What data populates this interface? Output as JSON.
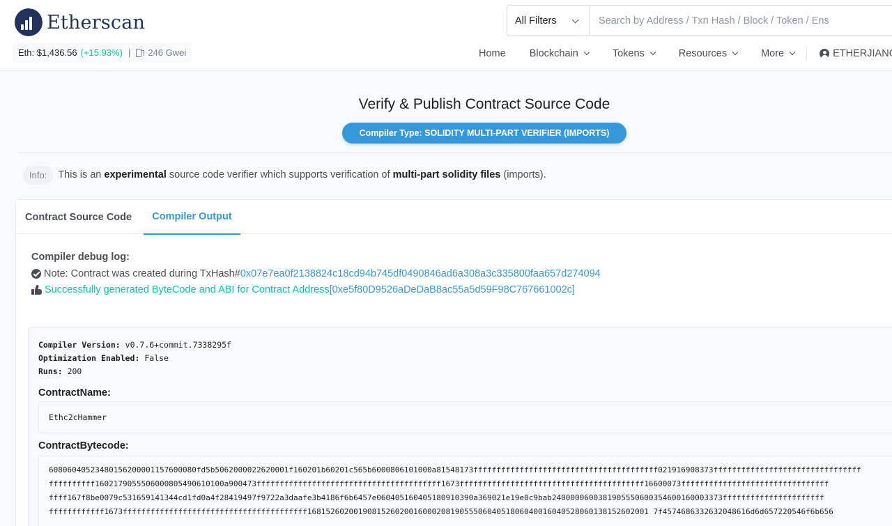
{
  "header": {
    "logo_text": "Etherscan",
    "price": {
      "label": "Eth: $1,436.56",
      "change": "(+15.93%)",
      "separator": "|",
      "gas": "246 Gwei"
    },
    "search": {
      "filter_label": "All Filters",
      "placeholder": "Search by Address / Txn Hash / Block / Token / Ens"
    },
    "nav": {
      "home": "Home",
      "blockchain": "Blockchain",
      "tokens": "Tokens",
      "resources": "Resources",
      "more": "More",
      "user": "ETHERJIANG"
    }
  },
  "page": {
    "title": "Verify & Publish Contract Source Code",
    "badge": "Compiler Type: SOLIDITY MULTI-PART VERIFIER (IMPORTS)",
    "info": {
      "pill": "Info:",
      "part1": "This is an ",
      "bold1": "experimental",
      "part2": " source code verifier which supports verification of ",
      "bold2": "multi-part solidity files",
      "part3": " (imports)."
    }
  },
  "tabs": {
    "source": "Contract Source Code",
    "output": "Compiler Output"
  },
  "output": {
    "debug_title": "Compiler debug log:",
    "log1_text": "Note: Contract was created during TxHash# ",
    "log1_hash": "0x07e7ea0f2138824c18cd94b745df0490846ad6a308a3c335800faa657d274094",
    "log2_text": "Successfully generated ByteCode and ABI for Contract Address ",
    "log2_address": "[0xe5f80D9526aDeDaB8ac55a5d59F98C767661002c]",
    "compiler_version_label": "Compiler Version:",
    "compiler_version": "v0.7.6+commit.7338295f",
    "optimization_label": "Optimization Enabled:",
    "optimization": "False",
    "runs_label": "Runs:",
    "runs": "200",
    "contract_name_label": "ContractName:",
    "contract_name": "Ethc2cHammer",
    "bytecode_label": "ContractBytecode:",
    "bytecode_lines": [
      "60806040523480156200001157600080fd5b5062000022620001f160201b60201c565b6000806101000a81548173ffffffffffffffffffffffffffffffffffffffff021916908373ffffffffffffffffffffffffffffffff",
      "ffffffffff1602179055506000805490610100a900473ffffffffffffffffffffffffffffffffffffffff1673ffffffffffffffffffffffffffffffffffffffff16600073ffffffffffffffffffffffffffffffff",
      "ffff167f8be0079c531659141344cd1fd0a4f28419497f9722a3daafe3b4186f6b6457e060405160405180910390a369021e19e0c9bab2400000600381905550600354600160003373ffffffffffffffffffffff",
      "ffffffffffff1673ffffffffffffffffffffffffffffffffffffffff16815260200190815260200160002081905550604051806040016040528060138152602001 7f4574686332632048616d6d657220546f6b656"
    ]
  }
}
